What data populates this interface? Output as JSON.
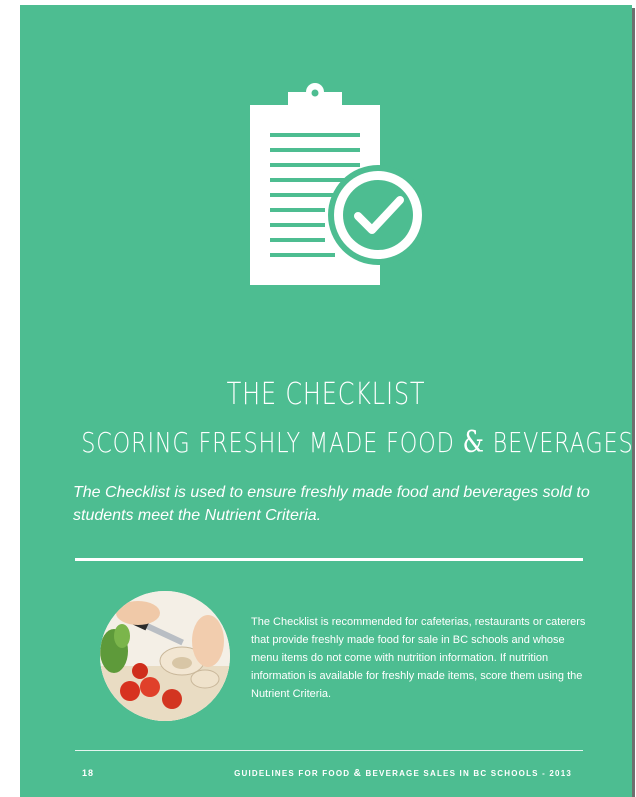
{
  "title_line1": "THE CHECKLIST",
  "title_line2_a": "SCORING FRESHLY MADE FOOD",
  "title_line2_amp": "&",
  "title_line2_b": "BEVERAGES",
  "intro": "The Checklist is used to ensure freshly made food and beverages sold to students meet the Nutrient Criteria.",
  "body": "The Checklist is recommended for cafeterias, restaurants or caterers that provide freshly made food for sale in BC schools and whose menu items do not come with nutrition information. If nutrition information is available for freshly made items, score them using the Nutrient Criteria.",
  "page_number": "18",
  "footer_a": "GUIDELINES FOR FOOD",
  "footer_amp": "&",
  "footer_b": "BEVERAGE SALES IN BC SCHOOLS - 2013",
  "colors": {
    "page_bg": "#4dbd91",
    "text": "#ffffff"
  },
  "icon": "clipboard-check-icon",
  "photo": "cutting-mushrooms-and-tomatoes"
}
